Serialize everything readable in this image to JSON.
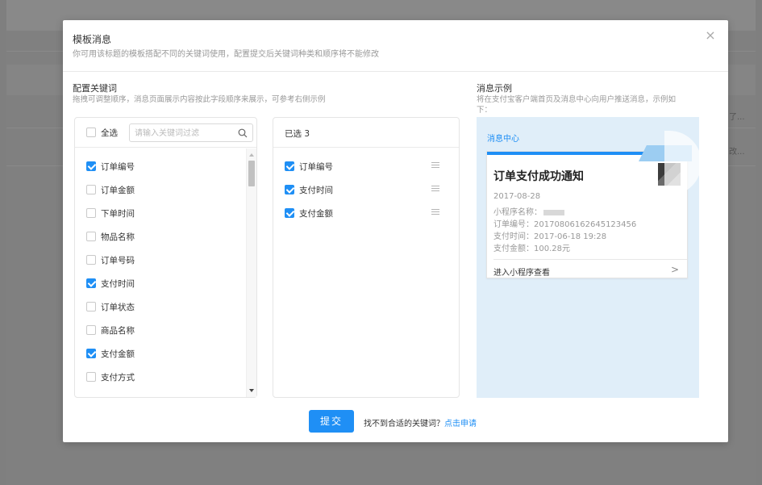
{
  "background": {
    "row1_trunc": "了...",
    "row2_trunc": "改..."
  },
  "modal": {
    "title": "模板消息",
    "subtitle": "你可用该标题的模板搭配不同的关键词使用，配置提交后关键词种类和顺序将不能修改",
    "close_icon": "close-icon"
  },
  "config": {
    "title": "配置关键词",
    "subtitle": "拖拽可调整顺序，消息页面展示内容按此字段顺序来展示，可参考右侧示例"
  },
  "keywords": {
    "select_all_label": "全选",
    "search_placeholder": "请输入关键词过滤",
    "items": [
      {
        "label": "订单编号",
        "checked": true
      },
      {
        "label": "订单金额",
        "checked": false
      },
      {
        "label": "下单时间",
        "checked": false
      },
      {
        "label": "物品名称",
        "checked": false
      },
      {
        "label": "订单号码",
        "checked": false
      },
      {
        "label": "支付时间",
        "checked": true
      },
      {
        "label": "订单状态",
        "checked": false
      },
      {
        "label": "商品名称",
        "checked": false
      },
      {
        "label": "支付金额",
        "checked": true
      },
      {
        "label": "支付方式",
        "checked": false
      }
    ]
  },
  "selected": {
    "header": "已选 3",
    "items": [
      {
        "label": "订单编号"
      },
      {
        "label": "支付时间"
      },
      {
        "label": "支付金额"
      }
    ]
  },
  "preview": {
    "title": "消息示例",
    "subtitle_line1": "将在支付宝客户端首页及消息中心向用户推送消息，示例如",
    "subtitle_line2": "下：",
    "center_label": "消息中心",
    "card_title": "订单支付成功通知",
    "date": "2017-08-28",
    "line_app": "小程序名称：",
    "line_order": "订单编号：20170806162645123456",
    "line_time": "支付时间：2017-06-18 19:28",
    "line_amount": "支付金额：100.28元",
    "enter_label": "进入小程序查看",
    "arrow": ">"
  },
  "footer": {
    "submit_label": "提交",
    "prompt": "找不到合适的关键词？",
    "link": "点击申请"
  },
  "colors": {
    "accent": "#1f8ff5",
    "preview_bg": "#e0eef9"
  }
}
